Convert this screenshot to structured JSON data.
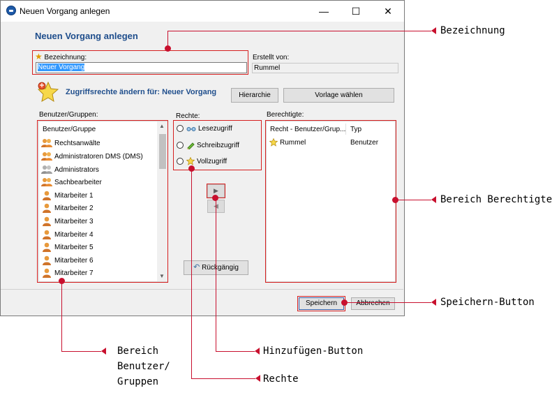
{
  "window": {
    "title": "Neuen Vorgang anlegen",
    "controls": {
      "minimize": "—",
      "maximize": "☐",
      "close": "✕"
    }
  },
  "dialog": {
    "heading": "Neuen Vorgang anlegen",
    "bezeichnung_label": "Bezeichnung:",
    "bezeichnung_value": "Neuer Vorgang",
    "erstellt_label": "Erstellt von:",
    "erstellt_value": "Rummel",
    "zugriff_text": "Zugriffsrechte ändern für: Neuer Vorgang",
    "hierarchie_label": "Hierarchie",
    "vorlage_label": "Vorlage wählen"
  },
  "users": {
    "label": "Benutzer/Gruppen:",
    "column": "Benutzer/Gruppe",
    "items": [
      {
        "name": "Rechtsanwälte",
        "icon": "group-icon"
      },
      {
        "name": "Administratoren DMS (DMS)",
        "icon": "group-icon"
      },
      {
        "name": "Administrators",
        "icon": "group-gray-icon"
      },
      {
        "name": "Sachbearbeiter",
        "icon": "group-icon"
      },
      {
        "name": "Mitarbeiter 1",
        "icon": "user-icon"
      },
      {
        "name": "Mitarbeiter 2",
        "icon": "user-icon"
      },
      {
        "name": "Mitarbeiter 3",
        "icon": "user-icon"
      },
      {
        "name": "Mitarbeiter 4",
        "icon": "user-icon"
      },
      {
        "name": "Mitarbeiter 5",
        "icon": "user-icon"
      },
      {
        "name": "Mitarbeiter 6",
        "icon": "user-icon"
      },
      {
        "name": "Mitarbeiter 7",
        "icon": "user-icon"
      }
    ]
  },
  "rechte": {
    "label": "Rechte:",
    "options": [
      "Lesezugriff",
      "Schreibzugriff",
      "Vollzugriff"
    ],
    "add_symbol": "▶",
    "remove_symbol": "◀",
    "undo_label": "Rückgängig"
  },
  "berechtigte": {
    "label": "Berechtigte:",
    "col_recht": "Recht - Benutzer/Grup...",
    "col_typ": "Typ",
    "rows": [
      {
        "name": "Rummel",
        "typ": "Benutzer"
      }
    ]
  },
  "footer": {
    "save_label": "Speichern",
    "cancel_label": "Abbrechen"
  },
  "annotations": {
    "bezeichnung": "Bezeichnung",
    "berechtigte": "Bereich Berechtigte",
    "speichern": "Speichern-Button",
    "benutzer_1": "Bereich",
    "benutzer_2": "Benutzer/",
    "benutzer_3": "Gruppen",
    "hinzufuegen": "Hinzufügen-Button",
    "rechte": "Rechte"
  },
  "colors": {
    "accent": "#1f4e8c",
    "annotation_red": "#c8102e",
    "selection": "#3399ff"
  }
}
